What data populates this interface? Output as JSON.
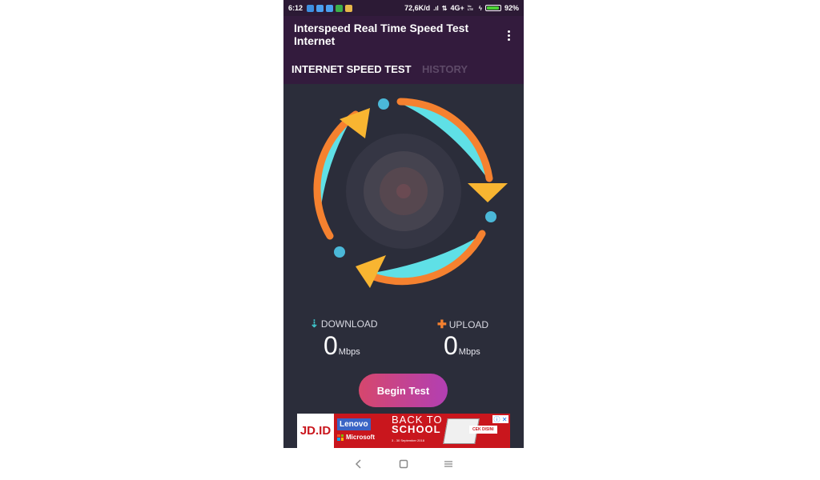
{
  "status_bar": {
    "time": "6:12",
    "network_speed": "72,6K/d",
    "network_type": "4G+",
    "volte": "Vo LTE",
    "battery": "92%",
    "battery_level": 0.92
  },
  "app": {
    "title": "Interspeed Real Time Speed Test Internet",
    "tabs": [
      {
        "label": "INTERNET SPEED TEST",
        "active": true
      },
      {
        "label": "HISTORY",
        "active": false
      }
    ]
  },
  "stats": {
    "download": {
      "label": "DOWNLOAD",
      "value": "0",
      "unit": "Mbps",
      "icon": "download-arrow-icon"
    },
    "upload": {
      "label": "UPLOAD",
      "value": "0",
      "unit": "Mbps",
      "icon": "upload-plus-icon"
    }
  },
  "begin_button": "Begin Test",
  "ad": {
    "logo": "JD.ID",
    "brand1": "Lenovo",
    "brand2": "Microsoft",
    "headline1": "BACK TO",
    "headline2": "SCHOOL",
    "dates": "3 - 30 September 2018",
    "cta": "CEK DISINI",
    "choices": "ⓘ ✕"
  },
  "colors": {
    "appbar": "#331b3d",
    "background": "#2b2d3a",
    "orange": "#f5812f",
    "yellow": "#f8b531",
    "cyan": "#5fe0e6",
    "button_start": "#d6476d",
    "button_end": "#b23fb3"
  },
  "nav": {
    "icons": [
      "back-icon",
      "home-icon",
      "recents-icon"
    ]
  }
}
